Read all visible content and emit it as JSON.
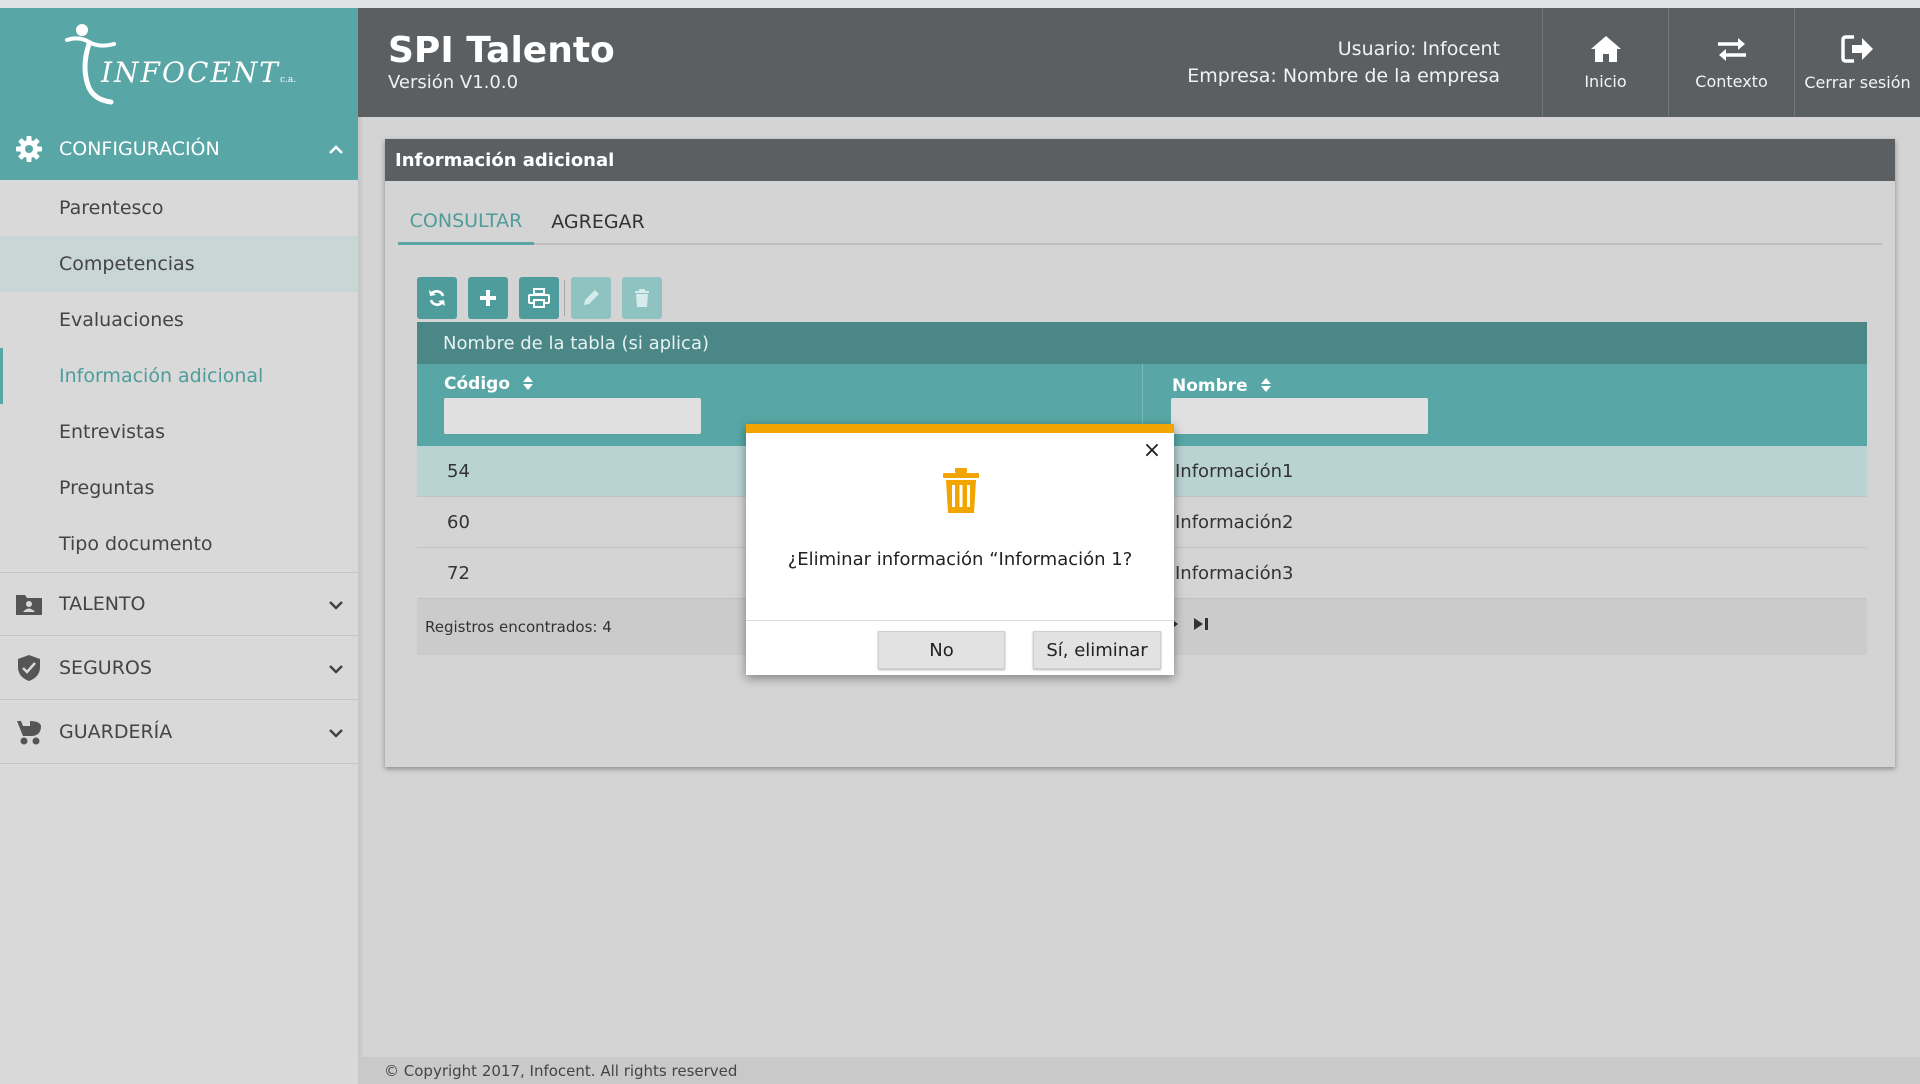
{
  "brand": {
    "logo_text": "INFOCENT",
    "logo_suffix": "c.a.",
    "app_title": "SPI Talento",
    "version": "Versión  V1.0.0",
    "user_line": "Usuario: Infocent",
    "company_line": "Empresa: Nombre de la empresa"
  },
  "header_buttons": [
    {
      "label": "Inicio",
      "icon": "home-icon"
    },
    {
      "label": "Contexto",
      "icon": "swap-arrows-icon"
    },
    {
      "label": "Cerrar sesión",
      "icon": "logout-icon"
    }
  ],
  "sidebar": {
    "sections": [
      {
        "label": "CONFIGURACIÓN",
        "icon": "gear-icon",
        "expanded": true
      },
      {
        "label": "TALENTO",
        "icon": "id-card-icon",
        "expanded": false
      },
      {
        "label": "SEGUROS",
        "icon": "shield-icon",
        "expanded": false
      },
      {
        "label": "GUARDERÍA",
        "icon": "stroller-icon",
        "expanded": false
      }
    ],
    "items": [
      {
        "label": "Parentesco"
      },
      {
        "label": "Competencias"
      },
      {
        "label": "Evaluaciones"
      },
      {
        "label": "Información adicional"
      },
      {
        "label": "Entrevistas"
      },
      {
        "label": "Preguntas"
      },
      {
        "label": "Tipo documento"
      }
    ]
  },
  "panel": {
    "title": "Información adicional",
    "tabs": [
      {
        "label": "CONSULTAR",
        "active": true
      },
      {
        "label": "AGREGAR",
        "active": false
      }
    ],
    "toolbar": [
      {
        "icon": "refresh-icon",
        "enabled": true
      },
      {
        "icon": "plus-icon",
        "enabled": true
      },
      {
        "icon": "print-icon",
        "enabled": true
      },
      {
        "icon": "pencil-icon",
        "enabled": false
      },
      {
        "icon": "trash-icon",
        "enabled": false
      }
    ],
    "table": {
      "caption": "Nombre de la tabla (si aplica)",
      "columns": [
        "Código",
        "Nombre"
      ],
      "rows": [
        {
          "codigo": "54",
          "nombre": "Información1"
        },
        {
          "codigo": "60",
          "nombre": "Información2"
        },
        {
          "codigo": "72",
          "nombre": "Información3"
        }
      ],
      "records_text": "Registros encontrados: 4"
    }
  },
  "modal": {
    "message": "¿Eliminar información “Información 1?",
    "no_label": "No",
    "yes_label": "Sí, eliminar",
    "close_glyph": "×"
  },
  "footer": {
    "copyright": "© Copyright 2017, Infocent. All rights reserved"
  },
  "colors": {
    "teal": "#58a7a6",
    "teal_dark": "#4a8786",
    "header_gray": "#5b5f62",
    "warning": "#f2a400"
  }
}
